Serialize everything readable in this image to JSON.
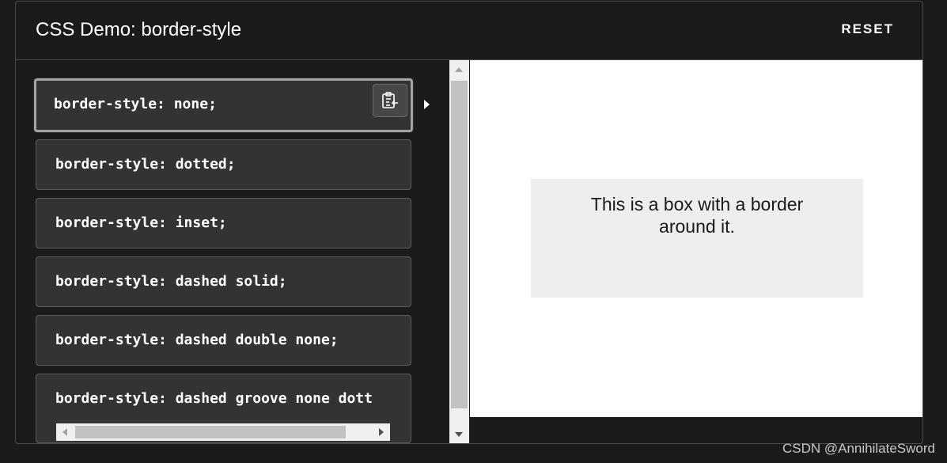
{
  "header": {
    "title": "CSS Demo: border-style",
    "reset_label": "RESET"
  },
  "choices": [
    {
      "code": "border-style: none;",
      "selected": true
    },
    {
      "code": "border-style: dotted;",
      "selected": false
    },
    {
      "code": "border-style: inset;",
      "selected": false
    },
    {
      "code": "border-style: dashed solid;",
      "selected": false
    },
    {
      "code": "border-style: dashed double none;",
      "selected": false
    },
    {
      "code": "border-style: dashed groove none dott",
      "selected": false
    }
  ],
  "icons": {
    "copy": "clipboard-copy-icon",
    "selected_marker": "play-triangle-icon"
  },
  "output": {
    "box_text": "This is a box with a border around it."
  },
  "watermark": "CSDN @AnnihilateSword"
}
